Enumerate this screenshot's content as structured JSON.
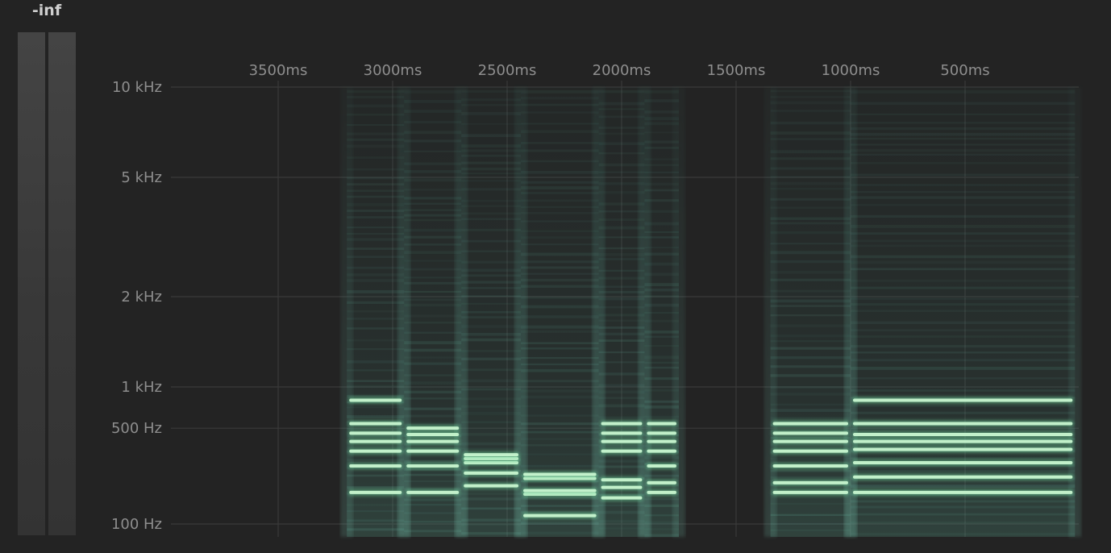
{
  "meter": {
    "readout": "-inf",
    "channels": [
      "left",
      "right"
    ],
    "level": 0
  },
  "colors": {
    "background": "#232323",
    "gridline": "#3a3a3a",
    "axis_text": "#8e8e8e",
    "harmonic_bright": "#c8f5d0",
    "harmonic_glow": "#6fd39a",
    "noise_tint": "#3d6d62"
  },
  "chart_data": {
    "type": "heatmap",
    "time_ticks": [
      "3500ms",
      "3000ms",
      "2500ms",
      "2000ms",
      "1500ms",
      "1000ms",
      "500ms"
    ],
    "time_tick_values_ms": [
      3500,
      3000,
      2500,
      2000,
      1500,
      1000,
      500
    ],
    "freq_ticks": [
      "10 kHz",
      "5 kHz",
      "2 kHz",
      "1 kHz",
      "500 Hz",
      "100 Hz"
    ],
    "freq_tick_values_hz": [
      10000,
      5000,
      2000,
      1000,
      500,
      100
    ],
    "freq_scale": "log",
    "time_range_ms": [
      3725,
      0
    ],
    "grid": true,
    "segments": [
      {
        "t_start_ms": 3200,
        "t_end_ms": 2950,
        "harmonics_hz": [
          170,
          265,
          340,
          400,
          460,
          540,
          800
        ]
      },
      {
        "t_start_ms": 2950,
        "t_end_ms": 2700,
        "harmonics_hz": [
          170,
          265,
          340,
          400,
          450,
          500
        ]
      },
      {
        "t_start_ms": 2700,
        "t_end_ms": 2440,
        "harmonics_hz": [
          190,
          235,
          280,
          300,
          320
        ]
      },
      {
        "t_start_ms": 2440,
        "t_end_ms": 2100,
        "harmonics_hz": [
          115,
          165,
          175,
          215,
          230
        ]
      },
      {
        "t_start_ms": 2100,
        "t_end_ms": 1900,
        "harmonics_hz": [
          155,
          185,
          210,
          340,
          400,
          460,
          540
        ]
      },
      {
        "t_start_ms": 1900,
        "t_end_ms": 1750,
        "harmonics_hz": [
          170,
          200,
          265,
          340,
          400,
          460,
          540
        ]
      },
      {
        "t_start_ms": 1350,
        "t_end_ms": 1000,
        "harmonics_hz": [
          170,
          200,
          265,
          340,
          400,
          460,
          540
        ]
      },
      {
        "t_start_ms": 1000,
        "t_end_ms": 20,
        "harmonics_hz": [
          170,
          220,
          280,
          350,
          400,
          450,
          540,
          800
        ]
      }
    ]
  }
}
